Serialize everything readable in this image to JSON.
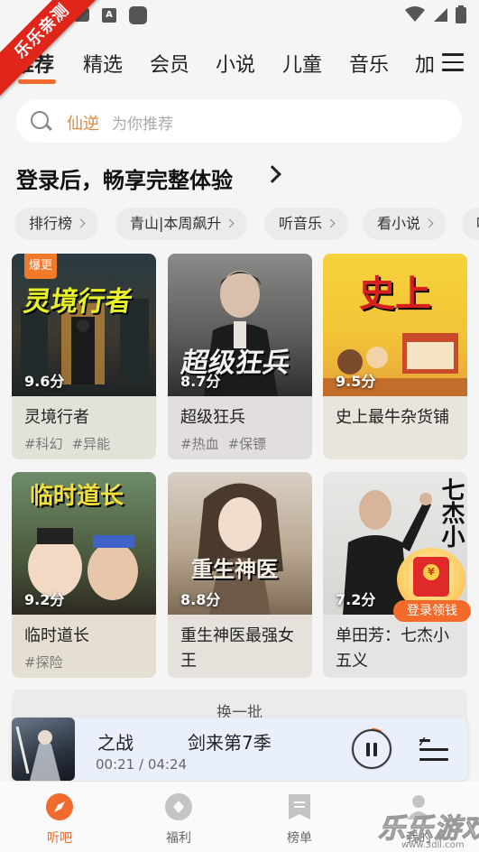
{
  "watermark": {
    "ribbon": "乐乐亲测",
    "brand": "乐乐游戏",
    "url": "www.3dll.com"
  },
  "tabs": [
    {
      "label": "推荐"
    },
    {
      "label": "精选"
    },
    {
      "label": "会员"
    },
    {
      "label": "小说"
    },
    {
      "label": "儿童"
    },
    {
      "label": "音乐"
    },
    {
      "label": "加"
    }
  ],
  "search": {
    "keyword": "仙逆",
    "placeholder": "为你推荐"
  },
  "login_banner": "登录后，畅享完整体验",
  "chips": [
    {
      "label": "排行榜"
    },
    {
      "label": "青山|本周飙升"
    },
    {
      "label": "听音乐"
    },
    {
      "label": "看小说"
    },
    {
      "label": "听"
    }
  ],
  "cards": [
    {
      "title": "灵境行者",
      "score": "9.6分",
      "tags": [
        "#科幻",
        "#异能"
      ],
      "badge": "爆更",
      "cover_text": "灵境行者"
    },
    {
      "title": "超级狂兵",
      "score": "8.7分",
      "tags": [
        "#热血",
        "#保镖"
      ],
      "cover_text": "超级狂兵"
    },
    {
      "title": "史上最牛杂货铺",
      "score": "9.5分",
      "tags": [],
      "cover_text": "史上"
    },
    {
      "title": "临时道长",
      "score": "9.2分",
      "tags": [
        "#探险"
      ],
      "cover_text": "临时道长"
    },
    {
      "title": "重生神医最强女王",
      "score": "8.8分",
      "tags": [],
      "cover_text": "重生神医"
    },
    {
      "title": "单田芳：七杰小五义",
      "score": "7.2分",
      "tags": [],
      "cover_text": "七杰小"
    }
  ],
  "refresh_label": "换一批",
  "promo_label": "登录领钱",
  "player": {
    "title": "之战　　　剑来第7季",
    "time": "00:21 / 04:24",
    "progress": 0.08
  },
  "nav": [
    {
      "label": "听吧",
      "icon": "compass-icon",
      "active": true
    },
    {
      "label": "福利",
      "icon": "diamond-icon",
      "active": false
    },
    {
      "label": "榜单",
      "icon": "bookmark-icon",
      "active": false
    },
    {
      "label": "我的",
      "icon": "profile-icon",
      "active": false
    }
  ],
  "colors": {
    "accent": "#f06b2d",
    "card_bg": "#e6e2dc"
  }
}
